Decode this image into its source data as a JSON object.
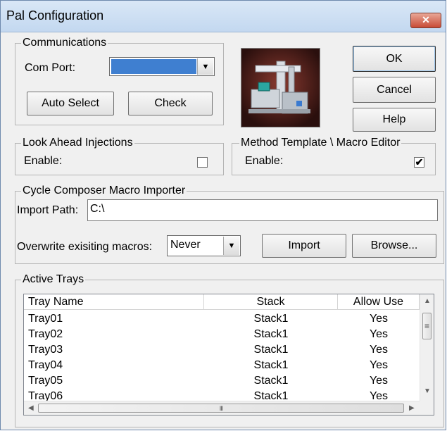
{
  "window": {
    "title": "Pal Configuration",
    "close_glyph": "✕"
  },
  "communications": {
    "legend": "Communications",
    "com_port_label": "Com Port:",
    "com_port_value": "",
    "auto_select_label": "Auto Select",
    "check_label": "Check"
  },
  "buttons": {
    "ok": "OK",
    "cancel": "Cancel",
    "help": "Help"
  },
  "look_ahead": {
    "legend": "Look Ahead Injections",
    "enable_label": "Enable:",
    "checked": false
  },
  "method_template": {
    "legend": "Method Template \\ Macro Editor",
    "enable_label": "Enable:",
    "checked": true,
    "check_glyph": "✔"
  },
  "cycle_composer": {
    "legend": "Cycle Composer Macro Importer",
    "import_path_label": "Import Path:",
    "import_path_value": "C:\\",
    "overwrite_label": "Overwrite exisiting macros:",
    "overwrite_value": "Never",
    "import_label": "Import",
    "browse_label": "Browse..."
  },
  "active_trays": {
    "legend": "Active Trays",
    "columns": {
      "tray_name": "Tray Name",
      "stack": "Stack",
      "allow_use": "Allow Use"
    },
    "rows": [
      {
        "tray": "Tray01",
        "stack": "Stack1",
        "allow": "Yes"
      },
      {
        "tray": "Tray02",
        "stack": "Stack1",
        "allow": "Yes"
      },
      {
        "tray": "Tray03",
        "stack": "Stack1",
        "allow": "Yes"
      },
      {
        "tray": "Tray04",
        "stack": "Stack1",
        "allow": "Yes"
      },
      {
        "tray": "Tray05",
        "stack": "Stack1",
        "allow": "Yes"
      },
      {
        "tray": "Tray06",
        "stack": "Stack1",
        "allow": "Yes"
      }
    ]
  },
  "icons": {
    "dropdown_arrow": "▼",
    "scroll_up": "▲",
    "scroll_down": "▼",
    "scroll_left": "◀",
    "scroll_right": "▶",
    "grip_v": "≡",
    "grip_h": "III"
  },
  "colors": {
    "com_port_highlight": "#3f7fd0",
    "title_bar": "#c9dbf1",
    "close_button": "#c84b36"
  }
}
